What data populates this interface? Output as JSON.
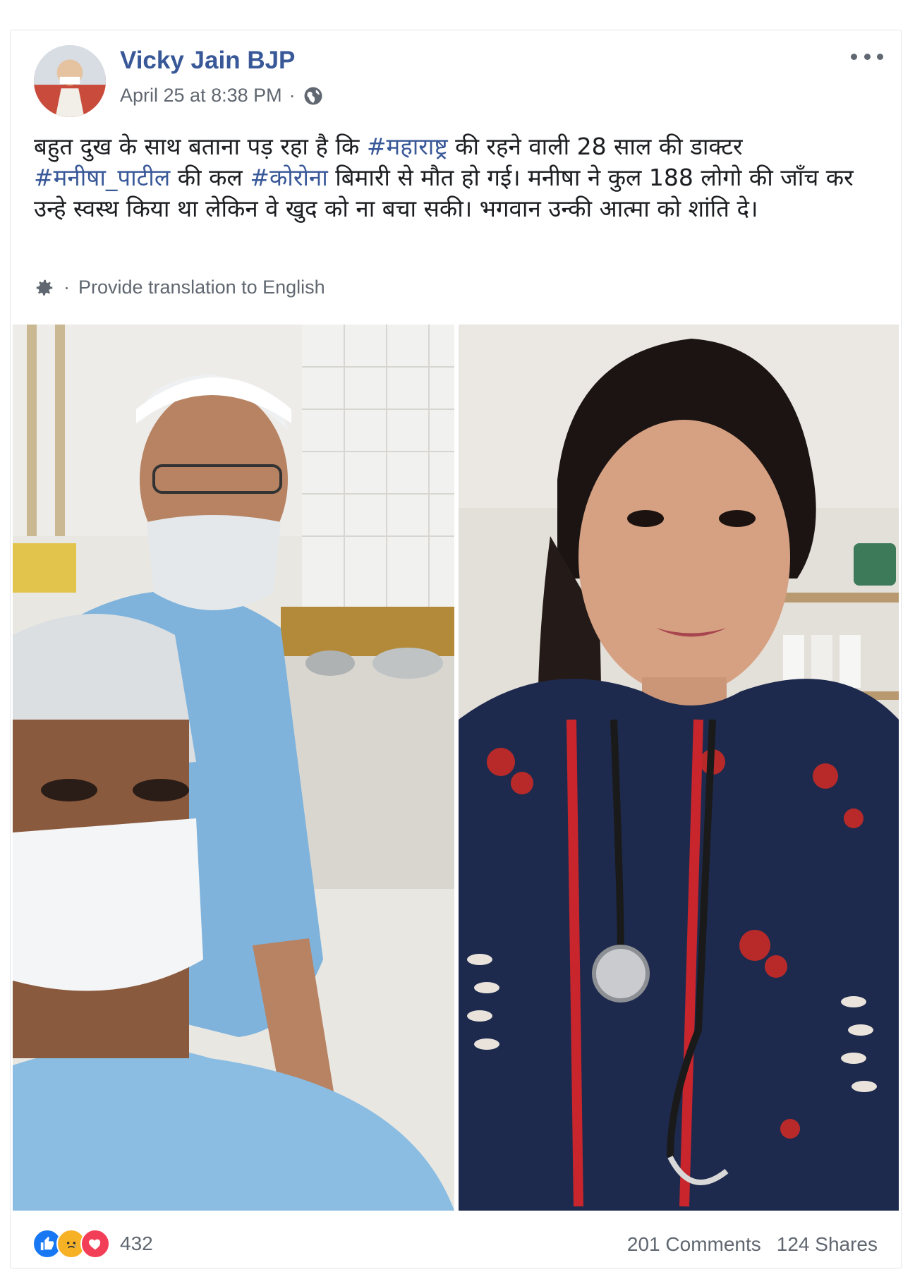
{
  "post": {
    "author": "Vicky Jain BJP",
    "timestamp": "April 25 at 8:38 PM",
    "separator": "·",
    "audience_icon": "globe-icon",
    "menu_icon": "more-options-icon",
    "text_parts": [
      {
        "t": "बहुत दुख के साथ बताना पड़ रहा है कि ",
        "tag": false
      },
      {
        "t": "#महाराष्ट्र",
        "tag": true
      },
      {
        "t": " की रहने वाली 28 साल की डाक्टर ",
        "tag": false
      },
      {
        "t": "#मनीषा_पाटील",
        "tag": true
      },
      {
        "t": " की कल ",
        "tag": false
      },
      {
        "t": "#कोरोना",
        "tag": true
      },
      {
        "t": " बिमारी से मौत हो गई। मनीषा ने कुल 188 लोगो की जाँच कर उन्हे स्वस्थ किया था लेकिन वे खुद को ना बचा सकी। भगवान उन्की आत्मा को शांति दे।",
        "tag": false
      }
    ],
    "translate_separator": "·",
    "translate_label": "Provide translation to English"
  },
  "photos": [
    {
      "icon": "photo-doctors-selfie"
    },
    {
      "icon": "photo-doctor-portrait"
    }
  ],
  "footer": {
    "reaction_icons": [
      "like-icon",
      "sad-icon",
      "love-icon"
    ],
    "reaction_count": "432",
    "comments": "201 Comments",
    "shares": "124 Shares"
  },
  "colors": {
    "link": "#385898",
    "meta": "#606770",
    "like": "#1877f2",
    "sad": "#f7b125",
    "love": "#f33e58"
  }
}
